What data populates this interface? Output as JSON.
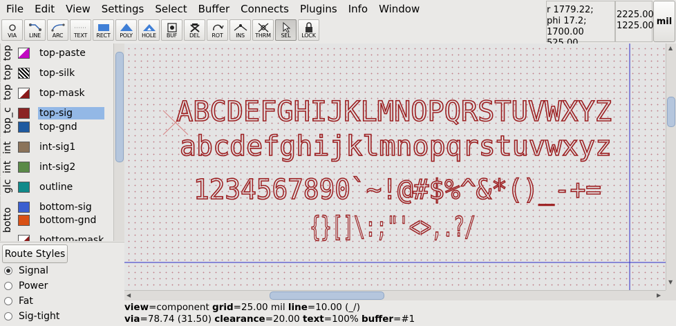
{
  "menu": [
    "File",
    "Edit",
    "View",
    "Settings",
    "Select",
    "Buffer",
    "Connects",
    "Plugins",
    "Info",
    "Window"
  ],
  "toolbar": [
    {
      "label": "VIA",
      "icon": "via-icon"
    },
    {
      "label": "LINE",
      "icon": "line-icon"
    },
    {
      "label": "ARC",
      "icon": "arc-icon"
    },
    {
      "label": "TEXT",
      "icon": "text-icon"
    },
    {
      "label": "RECT",
      "icon": "rectangle-icon"
    },
    {
      "label": "POLY",
      "icon": "polygon-icon"
    },
    {
      "label": "HOLE",
      "icon": "hole-icon"
    },
    {
      "label": "BUF",
      "icon": "buffer-icon"
    },
    {
      "label": "DEL",
      "icon": "delete-icon"
    },
    {
      "label": "ROT",
      "icon": "rotate-icon"
    },
    {
      "label": "INS",
      "icon": "insert-point-icon"
    },
    {
      "label": "THRM",
      "icon": "thermal-icon"
    },
    {
      "label": "SEL",
      "icon": "select-arrow-icon",
      "active": true
    },
    {
      "label": "LOCK",
      "icon": "lock-icon"
    }
  ],
  "coords": {
    "line1": "r 1779.22;",
    "line2": "phi 17.2;",
    "line3": "1700.00 525.00",
    "abs_x": "2225.00",
    "abs_y": "1225.00",
    "unit": "mil"
  },
  "layer_groups": [
    "top",
    "top",
    "top",
    "top_c",
    "int",
    "int",
    "glc",
    "botto"
  ],
  "layers": [
    {
      "name": "top-paste",
      "color": "#c20ac2",
      "pattern": "paste"
    },
    {
      "name": "top-silk",
      "color": "#000000",
      "pattern": "silk"
    },
    {
      "name": "top-mask",
      "color": "#8b1a1a",
      "pattern": "mask"
    },
    {
      "name": "top-sig",
      "color": "#8b2323",
      "selected": true
    },
    {
      "name": "top-gnd",
      "color": "#1f5aa0"
    },
    {
      "name": "int-sig1",
      "color": "#8b735a"
    },
    {
      "name": "int-sig2",
      "color": "#5a8a48"
    },
    {
      "name": "outline",
      "color": "#108a8a"
    },
    {
      "name": "bottom-sig",
      "color": "#3a5fd0"
    },
    {
      "name": "bottom-gnd",
      "color": "#d85015"
    },
    {
      "name": "bottom-mask",
      "color": "#8b1a1a",
      "pattern": "mask"
    }
  ],
  "route_styles": {
    "button": "Route Styles",
    "options": [
      {
        "label": "Signal",
        "selected": true
      },
      {
        "label": "Power"
      },
      {
        "label": "Fat"
      },
      {
        "label": "Sig-tight"
      }
    ]
  },
  "canvas": {
    "text_lines": [
      "ABCDEFGHIJKLMNOPQRSTUVWXYZ",
      "abcdefghijklmnopqrstuvwxyz",
      "1234567890`~!@#$%^&*()_-+=",
      "{}[]\\:;\"'<>,.?/"
    ],
    "text_color": "#9c1f21"
  },
  "status": {
    "line1": {
      "view_label": "view",
      "view": "component",
      "grid_label": "grid",
      "grid": "25.00 mil",
      "line_label": "line",
      "line": "10.00 (_/)"
    },
    "line2": {
      "via_label": "via",
      "via": "78.74 (31.50)",
      "clearance_label": "clearance",
      "clearance": "20.00",
      "text_label": "text",
      "text": "100%",
      "buffer_label": "buffer",
      "buffer": "#1"
    }
  }
}
